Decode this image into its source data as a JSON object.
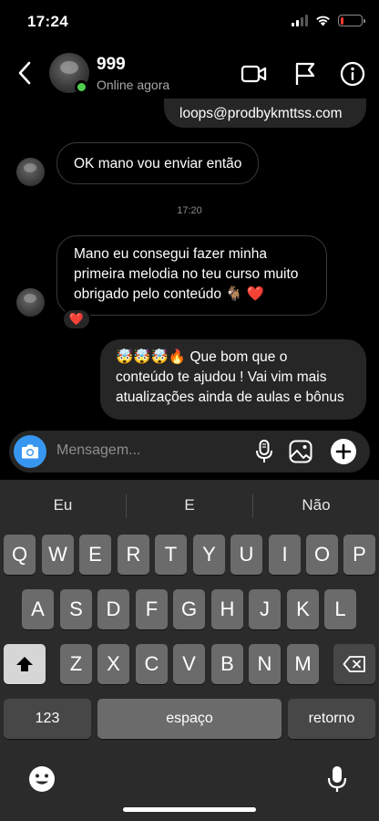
{
  "status_bar": {
    "time": "17:24"
  },
  "header": {
    "contact_name": "999",
    "contact_status": "Online agora"
  },
  "messages": {
    "email_msg": "loops@prodbykmttss.com",
    "ok_msg": "OK mano vou enviar então",
    "timestamp": "17:20",
    "melodia_msg": [
      "Mano eu consegui fazer minha",
      "primeira melodia no teu curso muito",
      "obrigado pelo conteúdo 🐐 ❤️"
    ],
    "reaction": "❤️",
    "reply_msg": [
      "🤯🤯🤯🔥 Que bom que o",
      "conteúdo te ajudou ! Vai vim mais",
      "atualizações ainda de aulas e bônus"
    ]
  },
  "composer": {
    "placeholder": "Mensagem..."
  },
  "keyboard": {
    "suggestions": [
      "Eu",
      "E",
      "Não"
    ],
    "row1": [
      "Q",
      "W",
      "E",
      "R",
      "T",
      "Y",
      "U",
      "I",
      "O",
      "P"
    ],
    "row2": [
      "A",
      "S",
      "D",
      "F",
      "G",
      "H",
      "J",
      "K",
      "L"
    ],
    "row3": [
      "Z",
      "X",
      "C",
      "V",
      "B",
      "N",
      "M"
    ],
    "numbers_key": "123",
    "space_key": "espaço",
    "return_key": "retorno"
  },
  "colors": {
    "online": "#4fcf4f",
    "camera_button": "#3797f0",
    "outgoing_bubble": "#262626",
    "battery_low": "#ff3b30"
  }
}
